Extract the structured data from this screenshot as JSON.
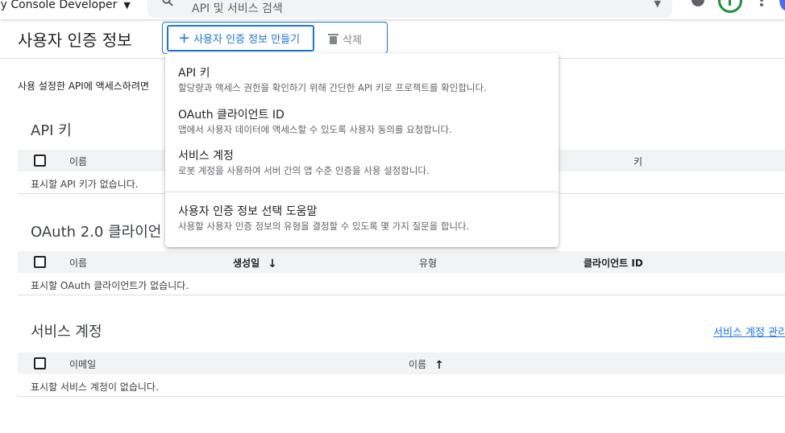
{
  "topbar": {
    "project_name": "ay Console Developer",
    "search_placeholder": "API 및 서비스 검색"
  },
  "header": {
    "title": "사용자 인증 정보",
    "create_label": "사용자 인증 정보 만들기",
    "delete_label": "삭제"
  },
  "intro_text": "사용 설정한 API에 액세스하려면",
  "api_keys": {
    "title": "API 키",
    "columns": [
      "이름",
      "키"
    ],
    "empty": "표시할 API 키가 없습니다."
  },
  "oauth": {
    "title": "OAuth 2.0 클라이언",
    "columns": [
      "이름",
      "생성일",
      "유형",
      "클라이언트 ID"
    ],
    "empty": "표시할 OAuth 클라이언트가 없습니다."
  },
  "service_accounts": {
    "title": "서비스 계정",
    "manage_link": "서비스 계정 관리",
    "columns": [
      "이메일",
      "이름"
    ],
    "empty": "표시할 서비스 계정이 없습니다."
  },
  "menu": {
    "items": [
      {
        "title": "API 키",
        "desc": "할당량과 액세스 권한을 확인하기 위해 간단한 API 키로 프로젝트를 확인합니다."
      },
      {
        "title": "OAuth 클라이언트 ID",
        "desc": "앱에서 사용자 데이터에 액세스할 수 있도록 사용자 동의를 요청합니다."
      },
      {
        "title": "서비스 계정",
        "desc": "로봇 계정을 사용하여 서버 간의 앱 수준 인증을 사용 설정합니다."
      },
      {
        "title": "사용자 인증 정보 선택 도움말",
        "desc": "사용할 사용자 인증 정보의 유형을 결정할 수 있도록 몇 가지 질문을 합니다."
      }
    ]
  },
  "colors": {
    "accent": "#1a73e8",
    "header_bg": "#f1f3f4",
    "divider": "#dadce0"
  },
  "icons": {
    "search": "search-icon",
    "help": "help-icon",
    "more": "more-vert-icon",
    "plus": "plus-icon",
    "trash": "trash-icon",
    "sort_down": "arrow-down-icon",
    "sort_up": "arrow-up-icon"
  }
}
